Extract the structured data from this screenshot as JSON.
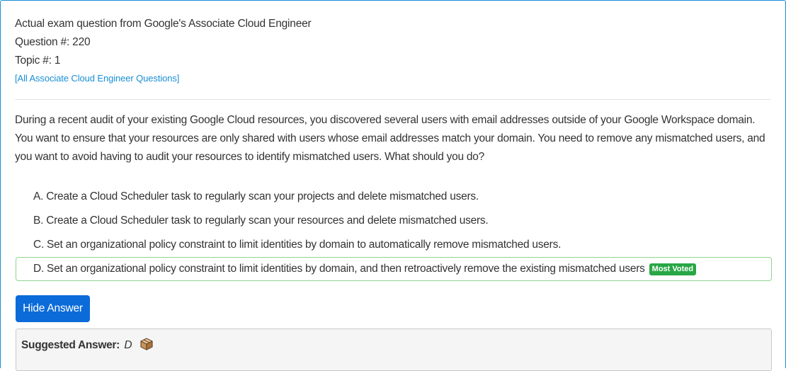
{
  "header": {
    "source_line": "Actual exam question from Google's Associate Cloud Engineer",
    "question_number": "Question #: 220",
    "topic_number": "Topic #: 1",
    "all_questions_link": "[All Associate Cloud Engineer Questions]"
  },
  "question": {
    "text": "During a recent audit of your existing Google Cloud resources, you discovered several users with email addresses outside of your Google Workspace domain. You want to ensure that your resources are only shared with users whose email addresses match your domain. You need to remove any mismatched users, and you want to avoid having to audit your resources to identify mismatched users. What should you do?"
  },
  "choices": [
    {
      "text": "A. Create a Cloud Scheduler task to regularly scan your projects and delete mismatched users."
    },
    {
      "text": "B. Create a Cloud Scheduler task to regularly scan your resources and delete mismatched users."
    },
    {
      "text": "C. Set an organizational policy constraint to limit identities by domain to automatically remove mismatched users."
    },
    {
      "text": "D. Set an organizational policy constraint to limit identities by domain, and then retroactively remove the existing mismatched users",
      "badge": "Most Voted"
    }
  ],
  "hide_answer_button": "Hide Answer",
  "suggested_answer": {
    "label": "Suggested Answer:",
    "value": "D",
    "icon": "box-icon"
  },
  "colors": {
    "link": "#1a8fd6",
    "button": "#0b6bd9",
    "badge": "#28a745",
    "voted_border": "#8fd68f"
  }
}
